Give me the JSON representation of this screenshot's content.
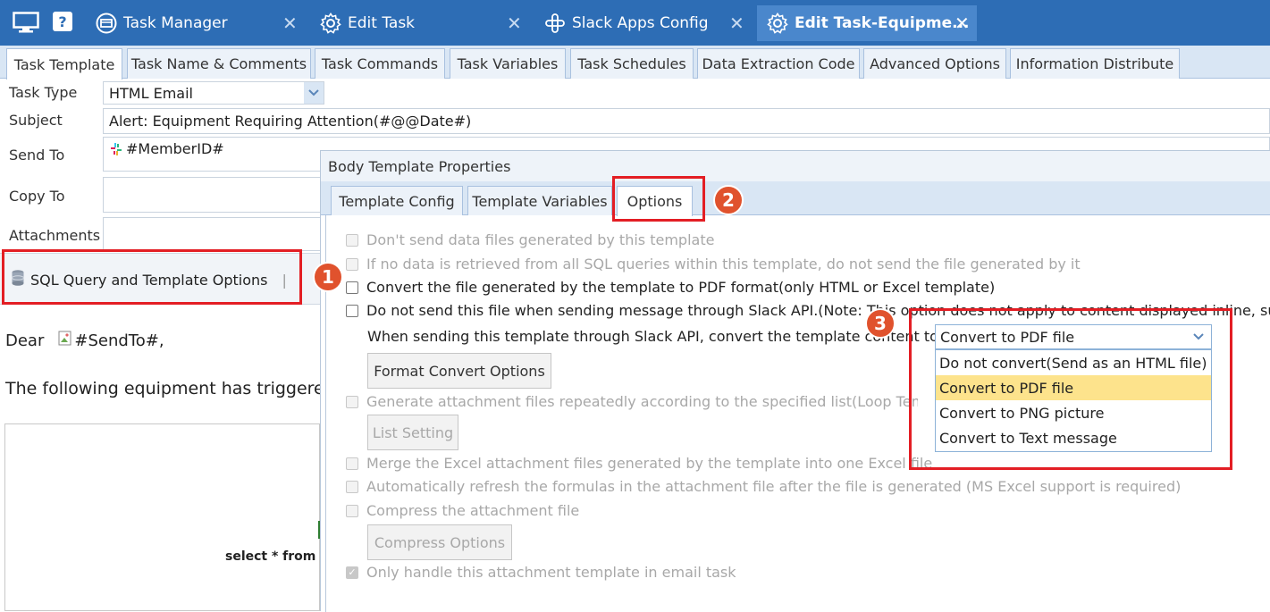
{
  "window_tabs": [
    {
      "label": "Task Manager",
      "icon": "task-manager-icon",
      "closable": true
    },
    {
      "label": "Edit Task",
      "icon": "gear-icon",
      "closable": true
    },
    {
      "label": "Slack Apps Config",
      "icon": "slack-icon",
      "closable": true
    },
    {
      "label": "Edit Task-Equipme...",
      "icon": "gear-icon",
      "closable": true,
      "active": true
    }
  ],
  "top_icons": {
    "monitor": "monitor-icon",
    "help": "?"
  },
  "sub_tabs": [
    {
      "label": "Task Template",
      "active": true
    },
    {
      "label": "Task Name & Comments"
    },
    {
      "label": "Task Commands"
    },
    {
      "label": "Task Variables"
    },
    {
      "label": "Task Schedules"
    },
    {
      "label": "Data Extraction Code"
    },
    {
      "label": "Advanced Options"
    },
    {
      "label": "Information Distribute"
    }
  ],
  "form": {
    "task_type_label": "Task Type",
    "task_type_value": "HTML Email",
    "subject_label": "Subject",
    "subject_value": "Alert: Equipment Requiring Attention(#@@Date#)",
    "send_to_label": "Send To",
    "send_to_value": "#MemberID#",
    "copy_to_label": "Copy To",
    "attachments_label": "Attachments",
    "sql_button_label": "SQL Query and Template Options",
    "separator": "|"
  },
  "preview": {
    "dear": "Dear",
    "send_to_token": "#SendTo#,",
    "line2": "The following equipment has triggere",
    "sql_snippet": "select * from e"
  },
  "dialog": {
    "title": "Body Template Properties",
    "tabs": [
      {
        "label": "Template Config"
      },
      {
        "label": "Template Variables"
      },
      {
        "label": "Options",
        "active": true
      }
    ],
    "options": [
      {
        "label": "Don't send data files generated by this template",
        "disabled": true,
        "checked": false
      },
      {
        "label": "If no data is retrieved from all SQL queries within this template, do not send the file generated by it",
        "disabled": true,
        "checked": false
      },
      {
        "label": "Convert the file generated by the template to PDF format(only HTML or Excel template)",
        "disabled": false,
        "checked": false
      },
      {
        "label": "Do not send this file when sending message through Slack API.(Note: This option does not apply to content displayed inline, su",
        "disabled": false,
        "checked": false
      }
    ],
    "slack_convert_label": "When sending this template through Slack API, convert the template content to",
    "format_convert_button": "Format Convert Options",
    "loop_option": "Generate attachment files repeatedly according to the specified list(Loop Templa",
    "list_setting_button": "List Setting",
    "merge_option": "Merge the Excel attachment files generated by the template into one Excel file",
    "refresh_option": "Automatically refresh the formulas in the attachment file after the file is generated (MS Excel support is required)",
    "compress_option": "Compress the attachment file",
    "compress_button": "Compress Options",
    "only_email_option": "Only handle this attachment template in email task",
    "convert_select": {
      "value": "Convert to PDF file",
      "options": [
        "Do not convert(Send as an HTML file)",
        "Convert to PDF file",
        "Convert to PNG picture",
        "Convert to Text message"
      ],
      "selected_index": 1
    }
  },
  "annotations": {
    "badge1": "1",
    "badge2": "2",
    "badge3": "3"
  },
  "colors": {
    "titlebar": "#2d6db5",
    "accent": "#e31e24",
    "badge": "#e0522d",
    "highlight": "#fde38c"
  }
}
